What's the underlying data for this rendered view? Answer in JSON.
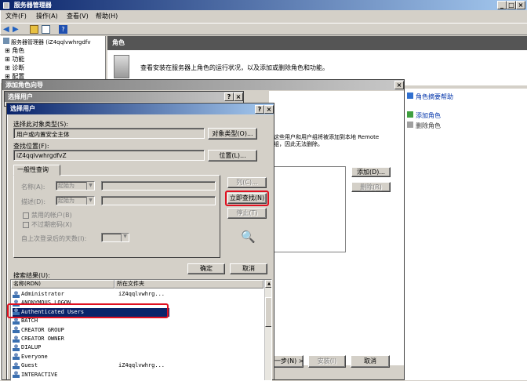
{
  "sm": {
    "title": "服务器管理器",
    "menu": [
      "文件(F)",
      "操作(A)",
      "查看(V)",
      "帮助(H)"
    ],
    "tree": [
      "服务器管理器 (iZ4qqlvwhrgdfv",
      "角色",
      "功能",
      "诊断",
      "配置"
    ],
    "pane_title": "角色",
    "desc": "查看安装在服务器上角色的运行状况，以及添加或删除角色和功能。",
    "right_help": "角色摘要帮助",
    "right_add": "添加角色",
    "right_remove": "删除角色"
  },
  "wizard": {
    "title": "添加角色向导",
    "text1": "这些用户和用户组将被添加到本地 Remote",
    "text2": "组，因此无法删除。",
    "add": "添加(D)...",
    "remove": "删除(R)",
    "next": "一步(N) >",
    "install": "安装(I)",
    "cancel": "取消"
  },
  "sel1": {
    "title": "选择用户"
  },
  "sel2": {
    "title": "选择用户",
    "type_label": "选择此对象类型(S):",
    "type_value": "用户或内置安全主体",
    "type_btn": "对象类型(O)...",
    "loc_label": "查找位置(F):",
    "loc_value": "iZ4qqlvwhrgdfvZ",
    "loc_btn": "位置(L)...",
    "tab": "一般性查询",
    "name_label": "名称(A):",
    "desc_label": "描述(D):",
    "starts": "起始为",
    "chk_disabled": "禁用的帐户(B)",
    "chk_noexp": "不过期密码(X)",
    "days_label": "自上次登录后的天数(I):",
    "col_btn": "列(C)...",
    "find_btn": "立即查找(N)",
    "stop_btn": "停止(T)",
    "ok": "确定",
    "cancel": "取消",
    "results_label": "搜索结果(U):",
    "col_name": "名称(RDN)",
    "col_folder": "所在文件夹",
    "rows": [
      {
        "name": "Administrator",
        "folder": "iZ4qqlvwhrg..."
      },
      {
        "name": "ANONYMOUS LOGON",
        "folder": ""
      },
      {
        "name": "Authenticated Users",
        "folder": ""
      },
      {
        "name": "BATCH",
        "folder": ""
      },
      {
        "name": "CREATOR GROUP",
        "folder": ""
      },
      {
        "name": "CREATOR OWNER",
        "folder": ""
      },
      {
        "name": "DIALUP",
        "folder": ""
      },
      {
        "name": "Everyone",
        "folder": ""
      },
      {
        "name": "Guest",
        "folder": "iZ4qqlvwhrg..."
      },
      {
        "name": "INTERACTIVE",
        "folder": ""
      }
    ]
  },
  "colors": {
    "title_active": "#0a246a",
    "highlight": "#e01020",
    "selected_row": "#0a246a"
  }
}
